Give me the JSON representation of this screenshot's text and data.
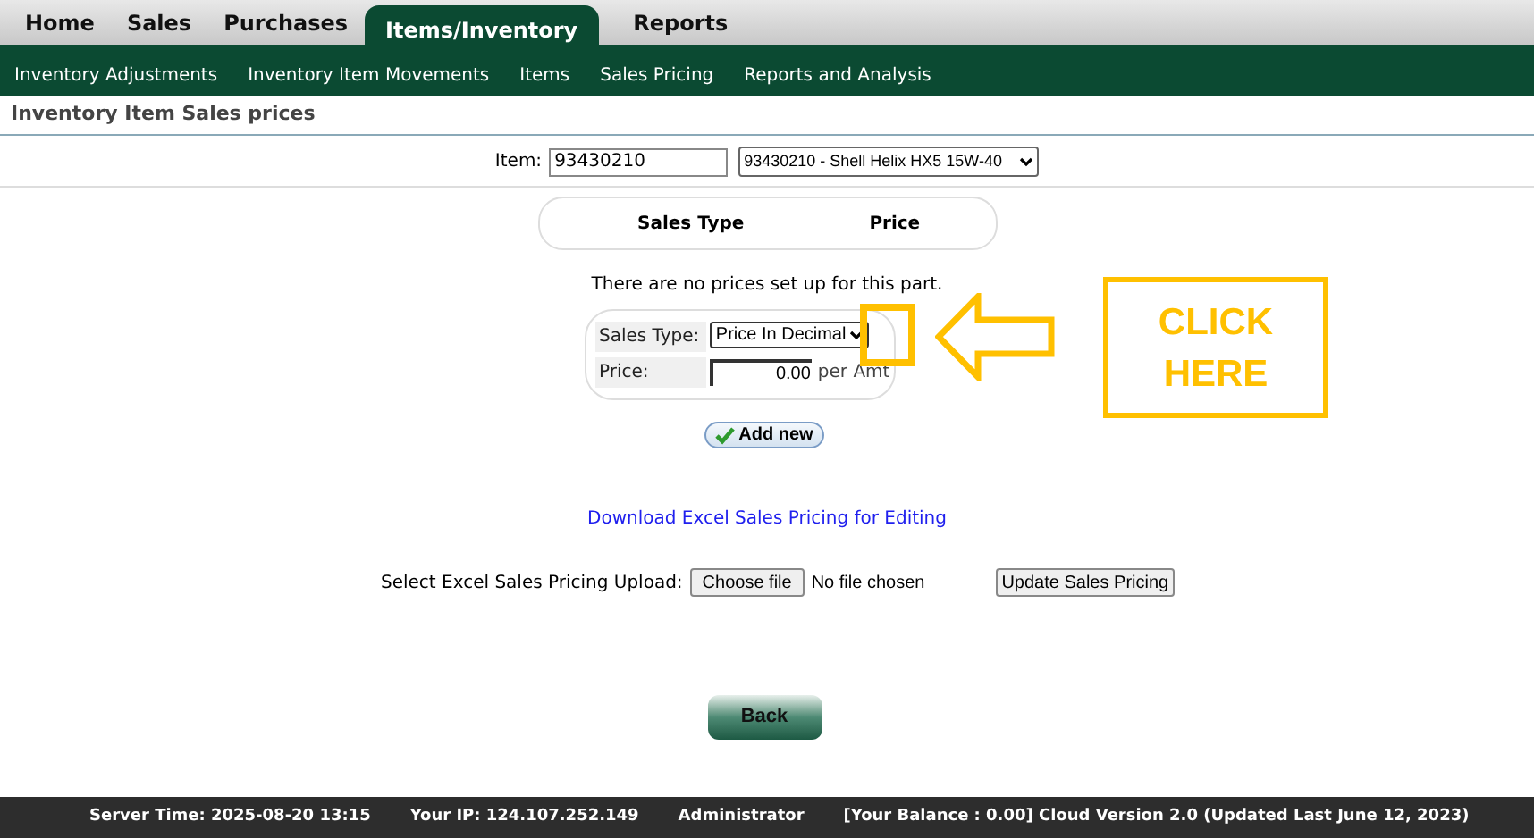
{
  "main_tabs": [
    {
      "label": "Home",
      "selected": false
    },
    {
      "label": "Sales",
      "selected": false
    },
    {
      "label": "Purchases",
      "selected": false
    },
    {
      "label": "Items/Inventory",
      "selected": true
    },
    {
      "label": "Reports",
      "selected": false
    }
  ],
  "sub_menu": [
    "Inventory Adjustments",
    "Inventory Item Movements",
    "Items",
    "Sales Pricing",
    "Reports and Analysis"
  ],
  "page_title": "Inventory Item Sales prices",
  "item": {
    "label": "Item:",
    "value": "93430210",
    "select_value": "93430210 - Shell Helix HX5 15W-40"
  },
  "table": {
    "columns": [
      "Sales Type",
      "Price"
    ]
  },
  "message": "There are no prices set up for this part.",
  "form": {
    "sales_type_label": "Sales Type:",
    "sales_type_value": "Price In Decimal",
    "price_label": "Price:",
    "price_value": "0.00",
    "price_unit": "per Amt"
  },
  "add_button": "Add new",
  "download_link": "Download Excel Sales Pricing for Editing",
  "upload": {
    "label": "Select Excel Sales Pricing Upload:",
    "choose_button": "Choose file",
    "file_status": "No file chosen",
    "update_button": "Update Sales Pricing"
  },
  "back_button": "Back",
  "annotation": {
    "callout": "CLICK HERE"
  },
  "footer": [
    "Server Time: 2025-08-20 13:15",
    "Your IP: 124.107.252.149",
    "Administrator",
    "[Your Balance : 0.00] Cloud Version 2.0 (Updated Last June 12, 2023)"
  ]
}
